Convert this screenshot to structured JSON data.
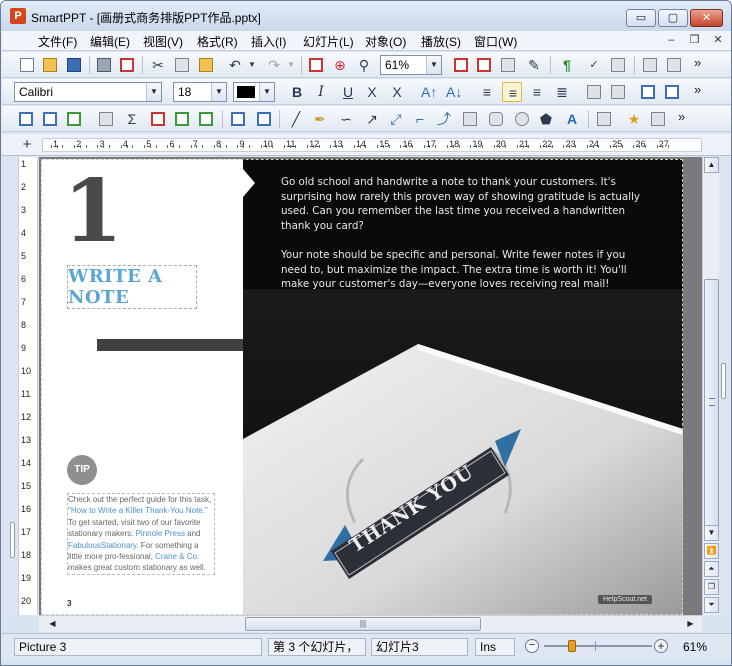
{
  "window": {
    "title": "SmartPPT - [画册式商务排版PPT作品.pptx]",
    "icon_letter": "P",
    "min_glyph": "▭",
    "max_glyph": "▢",
    "close_glyph": "✕"
  },
  "menu": {
    "items": [
      "文件(F)",
      "编辑(E)",
      "视图(V)",
      "格式(R)",
      "插入(I)",
      "幻灯片(L)",
      "对象(O)",
      "播放(S)",
      "窗口(W)"
    ],
    "doc_min": "–",
    "doc_restore": "❐",
    "doc_close": "✕"
  },
  "toolbar1": {
    "zoom_value": "61%",
    "more": "»"
  },
  "toolbar2": {
    "font_name": "Calibri",
    "font_size": "18",
    "more": "»",
    "bold": "B",
    "italic": "I",
    "underline": "U",
    "strike": "X",
    "clear": "X"
  },
  "toolbar3": {
    "more": "»"
  },
  "ruler": {
    "corner_glyph": "+",
    "h_numbers": [
      "1",
      "2",
      "3",
      "4",
      "5",
      "6",
      "7",
      "8",
      "9",
      "10",
      "11",
      "12",
      "13",
      "14",
      "15",
      "16",
      "17",
      "18",
      "19",
      "20",
      "21",
      "22",
      "23",
      "24",
      "25",
      "26",
      "27"
    ],
    "v_numbers": [
      "1",
      "2",
      "3",
      "4",
      "5",
      "6",
      "7",
      "8",
      "9",
      "10",
      "11",
      "12",
      "13",
      "14",
      "15",
      "16",
      "17",
      "18",
      "19",
      "20"
    ]
  },
  "slide": {
    "big_number": "1",
    "headline_line1": "WRITE A",
    "headline_line2": "NOTE",
    "tip_badge": "TIP",
    "caption": {
      "t1": "Check out the perfect guide for this task, ",
      "link1": "\"How to Write a Killer Thank-You Note.\"",
      "t2": " To get started, visit two of our favorite stationary makers: ",
      "link2": "Pinnole Press",
      "t3": " and ",
      "link3": "FabulousStationary.",
      "t4": " For something a little more pro-fessional, ",
      "link4": "Crane & Co.",
      "t5": " makes great custom stationary as well."
    },
    "page_number": "3",
    "paragraph1": "Go old school and handwrite a note to thank your customers. It's surprising how rarely this proven way of showing gratitude is actually used. Can you remember the last time you received a handwritten thank you card?",
    "paragraph2": "Your note should be specific and personal. Write fewer notes if you need to, but maximize the impact. The extra time is worth it! You'll make your customer's day—everyone loves receiving real mail!",
    "card_text": "THANK YOU",
    "watermark": "HelpScout.net"
  },
  "scroll": {
    "up": "▲",
    "down": "▼",
    "page_up": "⏶",
    "page_down": "⏷",
    "top": "⏫",
    "bottom": "⏬",
    "left": "◀",
    "right": "▶",
    "grip": "|||"
  },
  "status": {
    "object": "Picture 3",
    "slide_index": "第 3 个幻灯片，",
    "slide_name": "幻灯片3",
    "mode": "Ins",
    "zoom_pct": "61%",
    "zoom_minus": "−",
    "zoom_plus": "+"
  },
  "colors": {
    "headline": "#5aa5d4",
    "link": "#4b91c8",
    "ribbon": "#2f6fa3",
    "accent_knob": "#e6a125"
  }
}
